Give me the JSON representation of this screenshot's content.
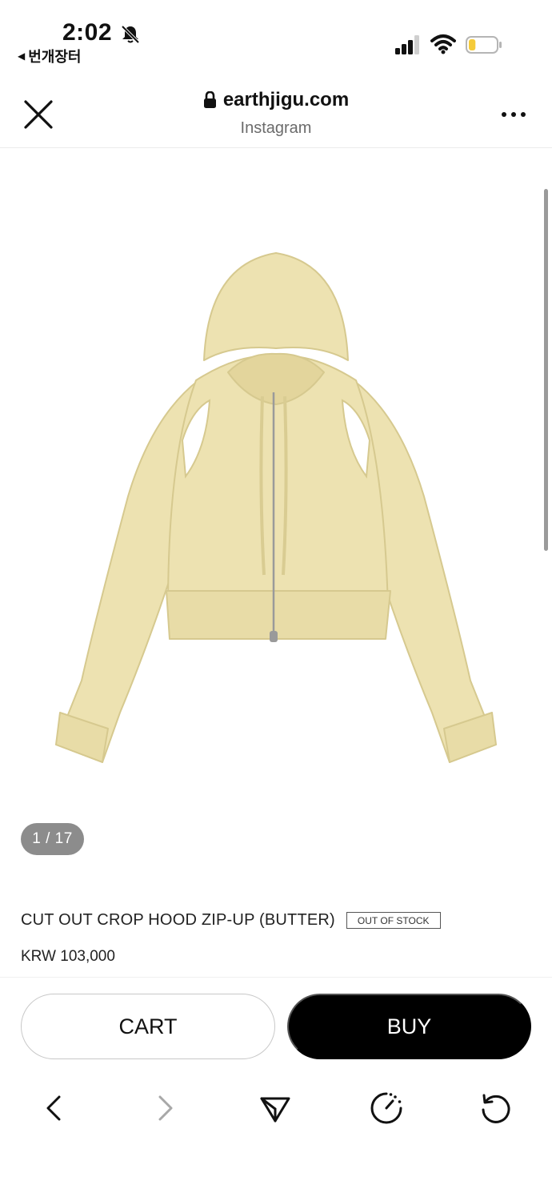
{
  "status_bar": {
    "time": "2:02",
    "back_app": "번개장터",
    "back_arrow": "◀",
    "icons": [
      "bell-slash-icon",
      "signal-icon",
      "wifi-icon",
      "battery-icon"
    ],
    "battery_level": 0.25,
    "battery_color": "#f5cb3a"
  },
  "browser": {
    "url": "earthjigu.com",
    "source": "Instagram",
    "close_icon": "close-icon",
    "more_icon": "more-icon",
    "lock_icon": "lock-icon"
  },
  "product": {
    "image_counter": "1 / 17",
    "title": "CUT OUT CROP HOOD ZIP-UP (BUTTER)",
    "stock_badge": "OUT OF STOCK",
    "price": "KRW 103,000",
    "color": "#ede2b1"
  },
  "actions": {
    "cart_label": "CART",
    "buy_label": "BUY"
  },
  "bottom_nav": {
    "items": [
      "back-icon",
      "forward-icon",
      "share-icon",
      "loading-icon",
      "reload-icon"
    ]
  }
}
